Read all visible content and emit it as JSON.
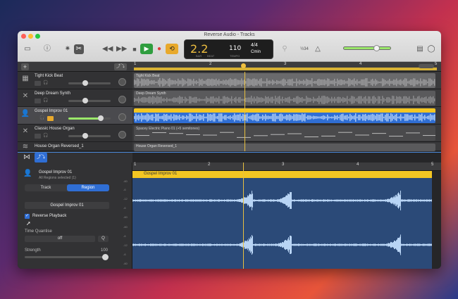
{
  "window": {
    "title": "Reverse Audio - Tracks"
  },
  "toolbar": {
    "lcd_position": "2.2",
    "lcd_bar_label": "BAR",
    "lcd_beat_label": "BEAT",
    "lcd_tempo": "110",
    "lcd_tempo_label": "TEMPO",
    "lcd_signature": "4/4",
    "lcd_key": "Cmin",
    "tuner_label": "½34",
    "volume_level": 0.65
  },
  "ruler": {
    "markers": [
      "1",
      "2",
      "3",
      "4",
      "5"
    ]
  },
  "tracks": [
    {
      "name": "Tight Kick Beat",
      "icon": "drum-machine-icon",
      "region": "Tight Kick Beat"
    },
    {
      "name": "Deep Dream Synth",
      "icon": "synth-icon",
      "region": "Deep Dream Synth"
    },
    {
      "name": "Gospel Improv 01",
      "icon": "user-icon",
      "region": "Gospel Improv 01",
      "selected": true
    },
    {
      "name": "Classic House Organ",
      "icon": "keyboard-icon",
      "region": "Spacey Electric Piano 01 (+5 semitones)"
    },
    {
      "name": "House Organ Reversed_1",
      "icon": "waveform-icon",
      "region": "House Organ Reversed_1"
    }
  ],
  "editor": {
    "track_name": "Gospel Improv 01",
    "track_sub": "All Regions selected (1)",
    "tab_track": "Track",
    "tab_region": "Region",
    "region_name": "Gospel Improv 01",
    "reverse_label": "Reverse Playback",
    "reverse_checked": true,
    "time_quantise_label": "Time Quantise",
    "time_quantise_value": "off",
    "q_button": "Q",
    "strength_label": "Strength",
    "strength_value": "100",
    "region_header": "Gospel Improv 01",
    "scale_labels": [
      "-60",
      "-6",
      "-12",
      "-6",
      "-60",
      "-60",
      "-6",
      "-12",
      "-6",
      "-60"
    ]
  }
}
